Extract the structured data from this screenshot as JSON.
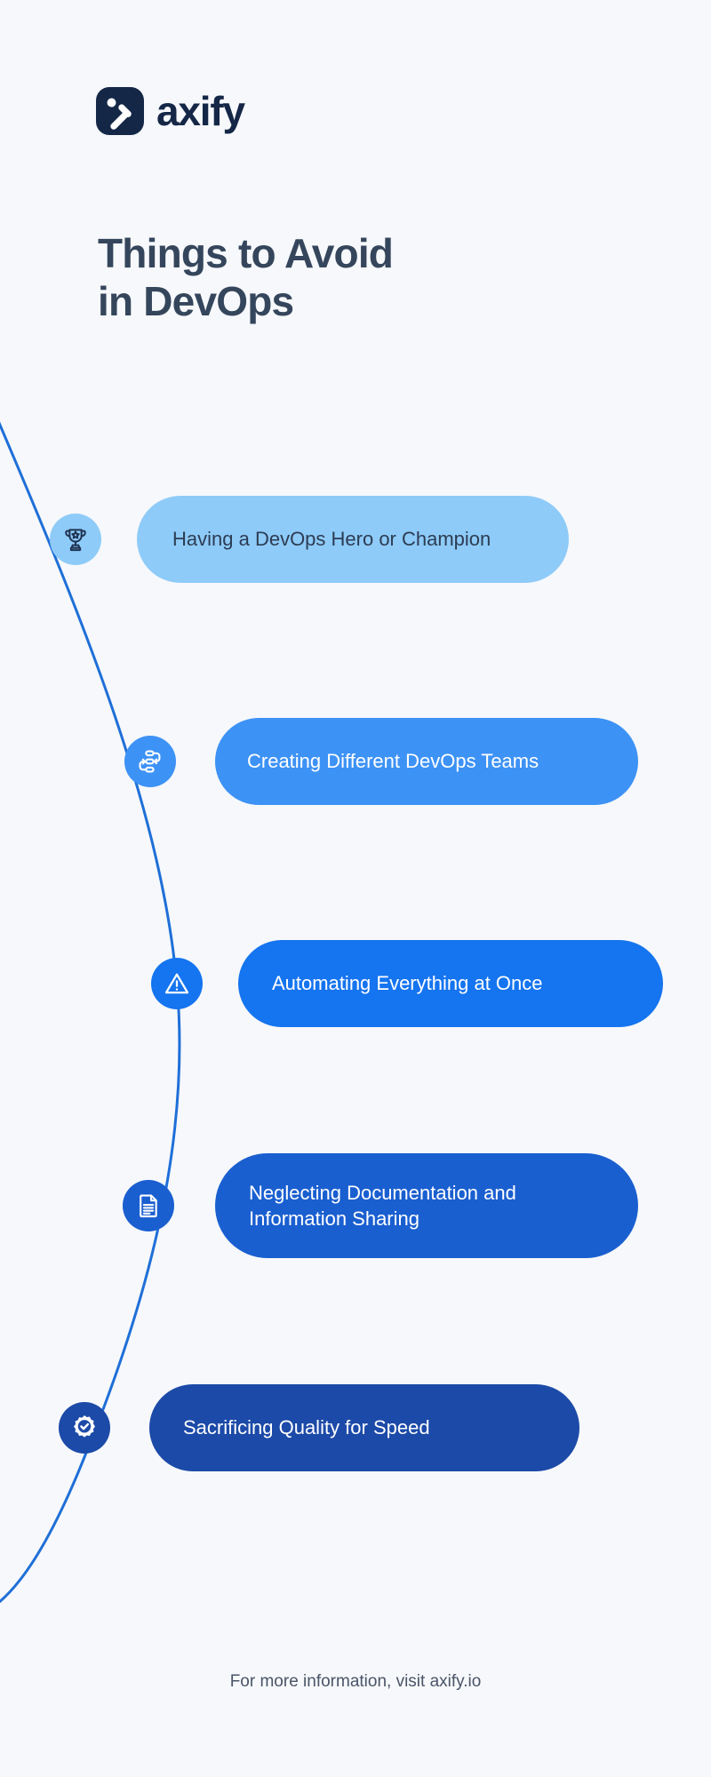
{
  "brand": {
    "name": "axify",
    "logo_icon": "axify-x-logo-icon",
    "logo_bg_color": "#152747",
    "wordmark_color": "#152747"
  },
  "header": {
    "title": "Things to Avoid\nin DevOps",
    "title_color": "#35465c"
  },
  "background_color": "#f6f8fb",
  "curve": {
    "color": "#1f6fd8",
    "stroke_width": 3
  },
  "items": [
    {
      "label": "Having a DevOps Hero or Champion",
      "icon": "trophy-icon",
      "node_bg": "#8ecbf8",
      "node_fg": "#1f3352",
      "pill_bg": "#8ecbf8",
      "pill_text_color": "#2d3c53"
    },
    {
      "label": "Creating Different DevOps Teams",
      "icon": "teams-workflow-icon",
      "node_bg": "#3d92f5",
      "node_fg": "#ffffff",
      "pill_bg": "#3d92f5",
      "pill_text_color": "#ffffff"
    },
    {
      "label": "Automating Everything at Once",
      "icon": "warning-triangle-icon",
      "node_bg": "#1574ef",
      "node_fg": "#ffffff",
      "pill_bg": "#1574ef",
      "pill_text_color": "#ffffff"
    },
    {
      "label": "Neglecting Documentation and\nInformation Sharing",
      "icon": "document-icon",
      "node_bg": "#1a5fd0",
      "node_fg": "#ffffff",
      "pill_bg": "#1a5fd0",
      "pill_text_color": "#ffffff"
    },
    {
      "label": "Sacrificing Quality for Speed",
      "icon": "quality-seal-check-icon",
      "node_bg": "#1c4aa8",
      "node_fg": "#ffffff",
      "pill_bg": "#1c4aa8",
      "pill_text_color": "#ffffff"
    }
  ],
  "footer": {
    "text": "For more information, visit axify.io"
  }
}
